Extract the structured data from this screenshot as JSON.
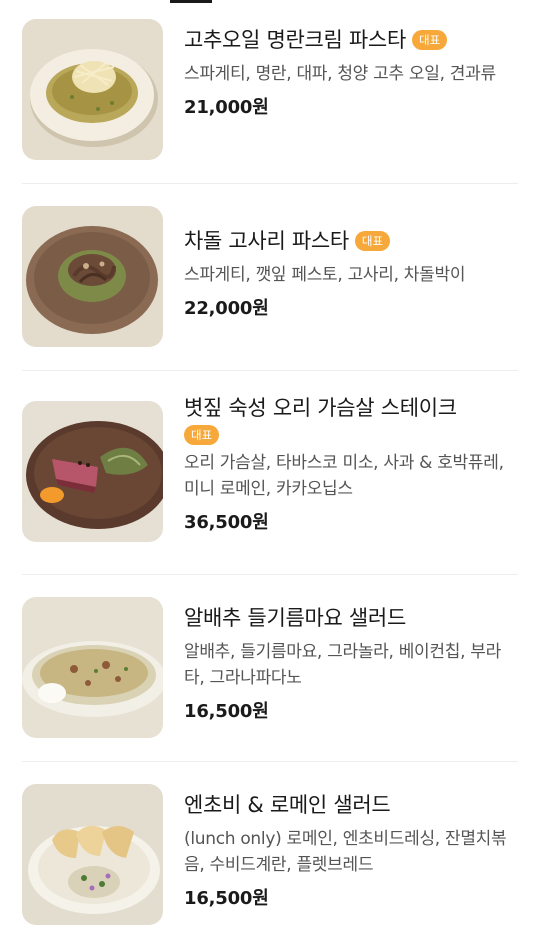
{
  "colors": {
    "badge_bg": "#f6a83a",
    "text_primary": "#1a1a1a",
    "text_secondary": "#555555",
    "divider": "#ededed"
  },
  "menu": {
    "items": [
      {
        "name": "고추오일 명란크림 파스타",
        "badge": "대표",
        "description": "스파게티, 명란, 대파, 청양 고추 오일, 견과류",
        "price": "21,000원",
        "image": "pasta-cream-dish-image"
      },
      {
        "name": "차돌 고사리 파스타",
        "badge": "대표",
        "description": "스파게티, 깻잎 페스토, 고사리, 차돌박이",
        "price": "22,000원",
        "image": "pasta-beef-dish-image"
      },
      {
        "name": "볏짚 숙성 오리 가슴살 스테이크",
        "badge": "대표",
        "description": "오리 가슴살, 타바스코 미소, 사과 & 호박퓨레, 미니 로메인, 카카오닙스",
        "price": "36,500원",
        "image": "duck-steak-dish-image"
      },
      {
        "name": "알배추 들기름마요 샐러드",
        "badge": null,
        "description": "알배추, 들기름마요, 그라놀라, 베이컨칩, 부라타, 그라나파다노",
        "price": "16,500원",
        "image": "cabbage-salad-dish-image"
      },
      {
        "name": "엔초비 & 로메인 샐러드",
        "badge": null,
        "description": "(lunch only) 로메인, 엔초비드레싱, 잔멸치볶음, 수비드계란, 플렛브레드",
        "price": "16,500원",
        "image": "anchovy-salad-dish-image"
      }
    ]
  }
}
